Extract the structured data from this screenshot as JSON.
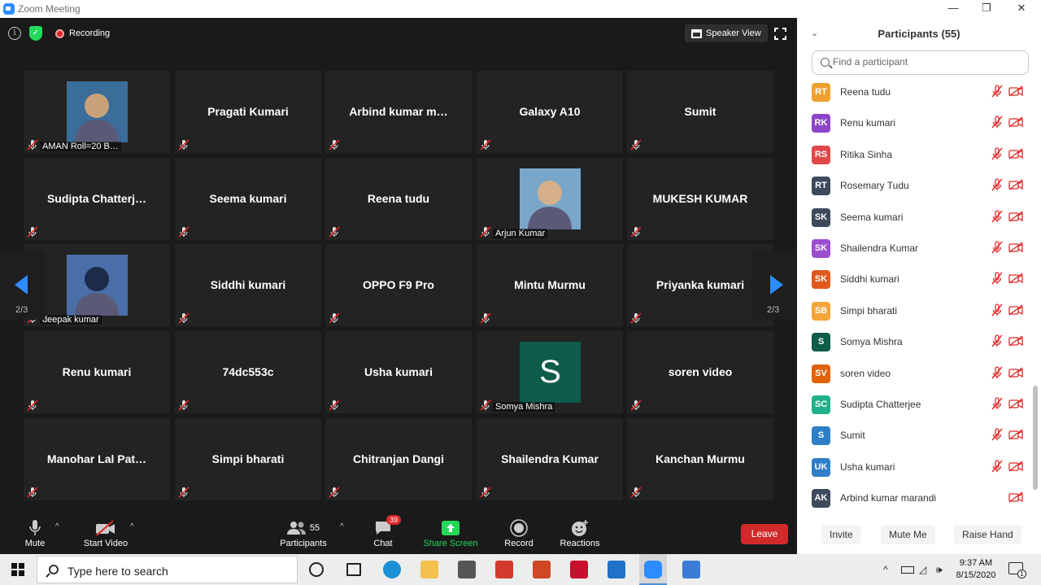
{
  "window": {
    "title": "Zoom Meeting",
    "minimize": "—",
    "restore": "❐",
    "close": "✕"
  },
  "meeting_bar": {
    "recording_label": "Recording",
    "speaker_view_label": "Speaker View"
  },
  "grid": {
    "tiles": [
      {
        "name": "AMAN Roll=20 B…",
        "photo": true
      },
      {
        "name": "Pragati Kumari"
      },
      {
        "name": "Arbind  kumar  m…"
      },
      {
        "name": "Galaxy A10"
      },
      {
        "name": "Sumit"
      },
      {
        "name": "Sudipta  Chatterj…"
      },
      {
        "name": "Seema kumari"
      },
      {
        "name": "Reena tudu"
      },
      {
        "name": "Arjun Kumar",
        "photo": true
      },
      {
        "name": "MUKESH KUMAR"
      },
      {
        "name": "deepak kumar",
        "photo": true
      },
      {
        "name": "Siddhi kumari"
      },
      {
        "name": "OPPO F9 Pro"
      },
      {
        "name": "Mintu Murmu"
      },
      {
        "name": "Priyanka kumari"
      },
      {
        "name": "Renu kumari"
      },
      {
        "name": "74dc553c"
      },
      {
        "name": "Usha kumari"
      },
      {
        "name": "Somya Mishra",
        "letter": "S"
      },
      {
        "name": "soren video"
      },
      {
        "name": "Manohar  Lal  Pat…"
      },
      {
        "name": "Simpi bharati"
      },
      {
        "name": "Chitranjan Dangi"
      },
      {
        "name": "Shailendra Kumar"
      },
      {
        "name": "Kanchan Murmu"
      }
    ],
    "page_left": "2/3",
    "page_right": "2/3"
  },
  "toolbar": {
    "mute_label": "Mute",
    "video_label": "Start Video",
    "participants_label": "Participants",
    "participants_count": "55",
    "chat_label": "Chat",
    "chat_badge": "39",
    "share_label": "Share Screen",
    "record_label": "Record",
    "reactions_label": "Reactions",
    "leave_label": "Leave",
    "caret": "^"
  },
  "panel": {
    "title": "Participants (55)",
    "search_placeholder": "Find a participant",
    "participants": [
      {
        "initials": "RT",
        "name": "Reena tudu",
        "color": "#f0a030",
        "mic_muted": true
      },
      {
        "initials": "RK",
        "name": "Renu kumari",
        "color": "#8e44c8",
        "mic_muted": true
      },
      {
        "initials": "RS",
        "name": "Ritika Sinha",
        "color": "#e04848",
        "mic_muted": true
      },
      {
        "initials": "RT",
        "name": "Rosemary Tudu",
        "color": "#3c4a5c",
        "mic_muted": true
      },
      {
        "initials": "SK",
        "name": "Seema kumari",
        "color": "#3c4a5c",
        "mic_muted": true
      },
      {
        "initials": "SK",
        "name": "Shailendra Kumar",
        "color": "#9b4fcf",
        "mic_muted": true
      },
      {
        "initials": "SK",
        "name": "Siddhi kumari",
        "color": "#e05a1e",
        "mic_muted": true
      },
      {
        "initials": "SB",
        "name": "Simpi bharati",
        "color": "#f3a43a",
        "mic_muted": true
      },
      {
        "initials": "S",
        "name": "Somya Mishra",
        "color": "#0e5c4a",
        "mic_muted": true
      },
      {
        "initials": "SV",
        "name": "soren video",
        "color": "#e0620a",
        "mic_muted": true
      },
      {
        "initials": "SC",
        "name": "Sudipta Chatterjee",
        "color": "#20b08a",
        "mic_muted": true
      },
      {
        "initials": "S",
        "name": "Sumit",
        "color": "#2f7ec8",
        "mic_muted": true
      },
      {
        "initials": "UK",
        "name": "Usha kumari",
        "color": "#2f7ec8",
        "mic_muted": true
      },
      {
        "initials": "AK",
        "name": "Arbind kumar marandi",
        "color": "#3c4a5c",
        "mic_muted": false
      }
    ],
    "invite_label": "Invite",
    "mute_me_label": "Mute Me",
    "raise_hand_label": "Raise Hand"
  },
  "taskbar": {
    "search_placeholder": "Type here to search",
    "time": "9:37 AM",
    "date": "8/15/2020",
    "notification_count": "1"
  },
  "colors": {
    "accent": "#2d8cff",
    "leave": "#d22a2a",
    "share": "#23d959",
    "muted_icon": "#e02828"
  }
}
